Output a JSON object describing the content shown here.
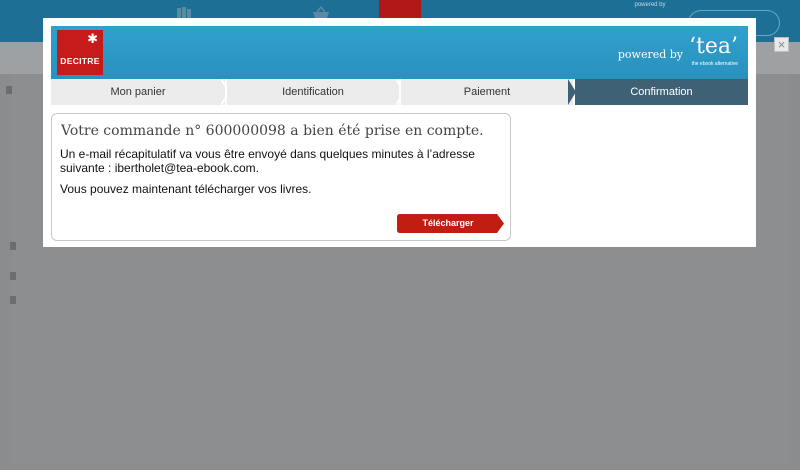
{
  "background": {
    "powered_small": "powered by"
  },
  "modal": {
    "brand": "DECITRE",
    "powered_by": "powered by",
    "tea_logo": "‘tea’",
    "tea_tagline": "the ebook alternative",
    "close_label": "×",
    "steps": [
      {
        "label": "Mon panier",
        "active": false
      },
      {
        "label": "Identification",
        "active": false
      },
      {
        "label": "Paiement",
        "active": false
      },
      {
        "label": "Confirmation",
        "active": true
      }
    ],
    "confirmation": {
      "heading": "Votre commande n° 600000098 a bien été prise en compte.",
      "email_message": "Un e-mail récapitulatif va vous être envoyé dans quelques minutes à l’adresse suivante : ibertholet@tea-ebook.com.",
      "download_message": "Vous pouvez maintenant télécharger vos livres.",
      "download_button": "Télécharger"
    }
  },
  "colors": {
    "header_blue": "#2a91bd",
    "brand_red": "#c61b1b",
    "active_step": "#3f6175",
    "inactive_step": "#ececec"
  }
}
